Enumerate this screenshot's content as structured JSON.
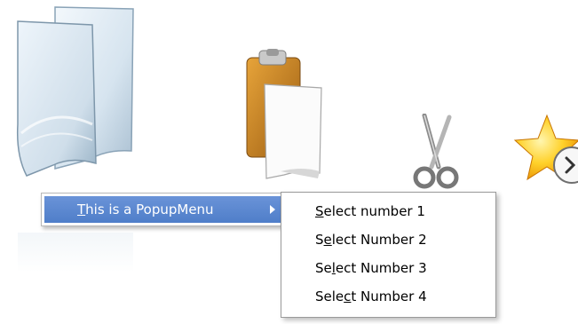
{
  "dock": {
    "icons": [
      "documents-icon",
      "clipboard-icon",
      "scissors-icon",
      "star-icon",
      "scroll-right-icon"
    ]
  },
  "popup": {
    "item": {
      "mnemonic": "T",
      "rest": "his is a PopupMenu",
      "arrow_icon": "chevron-right-icon"
    }
  },
  "submenu": {
    "items": [
      {
        "pre": "",
        "mnemonic": "S",
        "post": "elect number 1"
      },
      {
        "pre": "S",
        "mnemonic": "e",
        "post": "lect Number 2"
      },
      {
        "pre": "Se",
        "mnemonic": "l",
        "post": "ect Number 3"
      },
      {
        "pre": "Sele",
        "mnemonic": "c",
        "post": "t Number 4"
      }
    ]
  },
  "colors": {
    "highlight": "#5a86cf",
    "menu_border": "#9a9a9a",
    "background": "#ffffff"
  }
}
